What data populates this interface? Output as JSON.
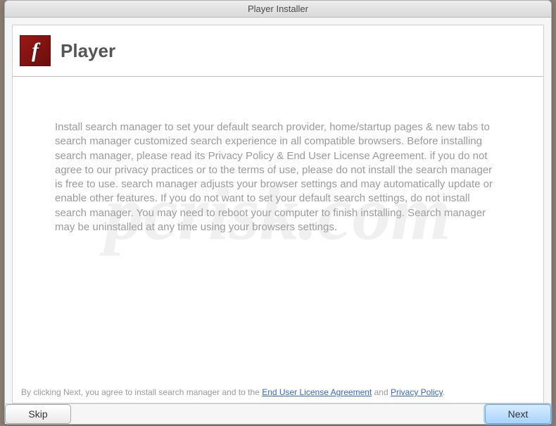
{
  "window": {
    "title": "Player Installer"
  },
  "header": {
    "icon_name": "flash-icon",
    "title": "Player"
  },
  "body": {
    "text": "Install search manager to set your default search provider, home/startup pages & new tabs to search manager customized search experience in all compatible browsers. Before installing search manager, please read its Privacy Policy & End User License Agreement. if you do not agree to our privacy practices or to the terms of use, please do not install the search manager is free to use. search manager adjusts your browser settings and may automatically update or enable other features. If you do not want to set your default search settings, do not install search manager. You may need to reboot your computer to finish installing. Search manager may be uninstalled at any time using your browsers settings."
  },
  "footer": {
    "prefix": "By clicking Next, you agree to install search manager and to the ",
    "eula_link": "End User License Agreement",
    "and_text": " and ",
    "privacy_link": "Privacy Policy",
    "suffix": "."
  },
  "buttons": {
    "skip": "Skip",
    "next": "Next"
  },
  "watermark": "pcrisk.com"
}
